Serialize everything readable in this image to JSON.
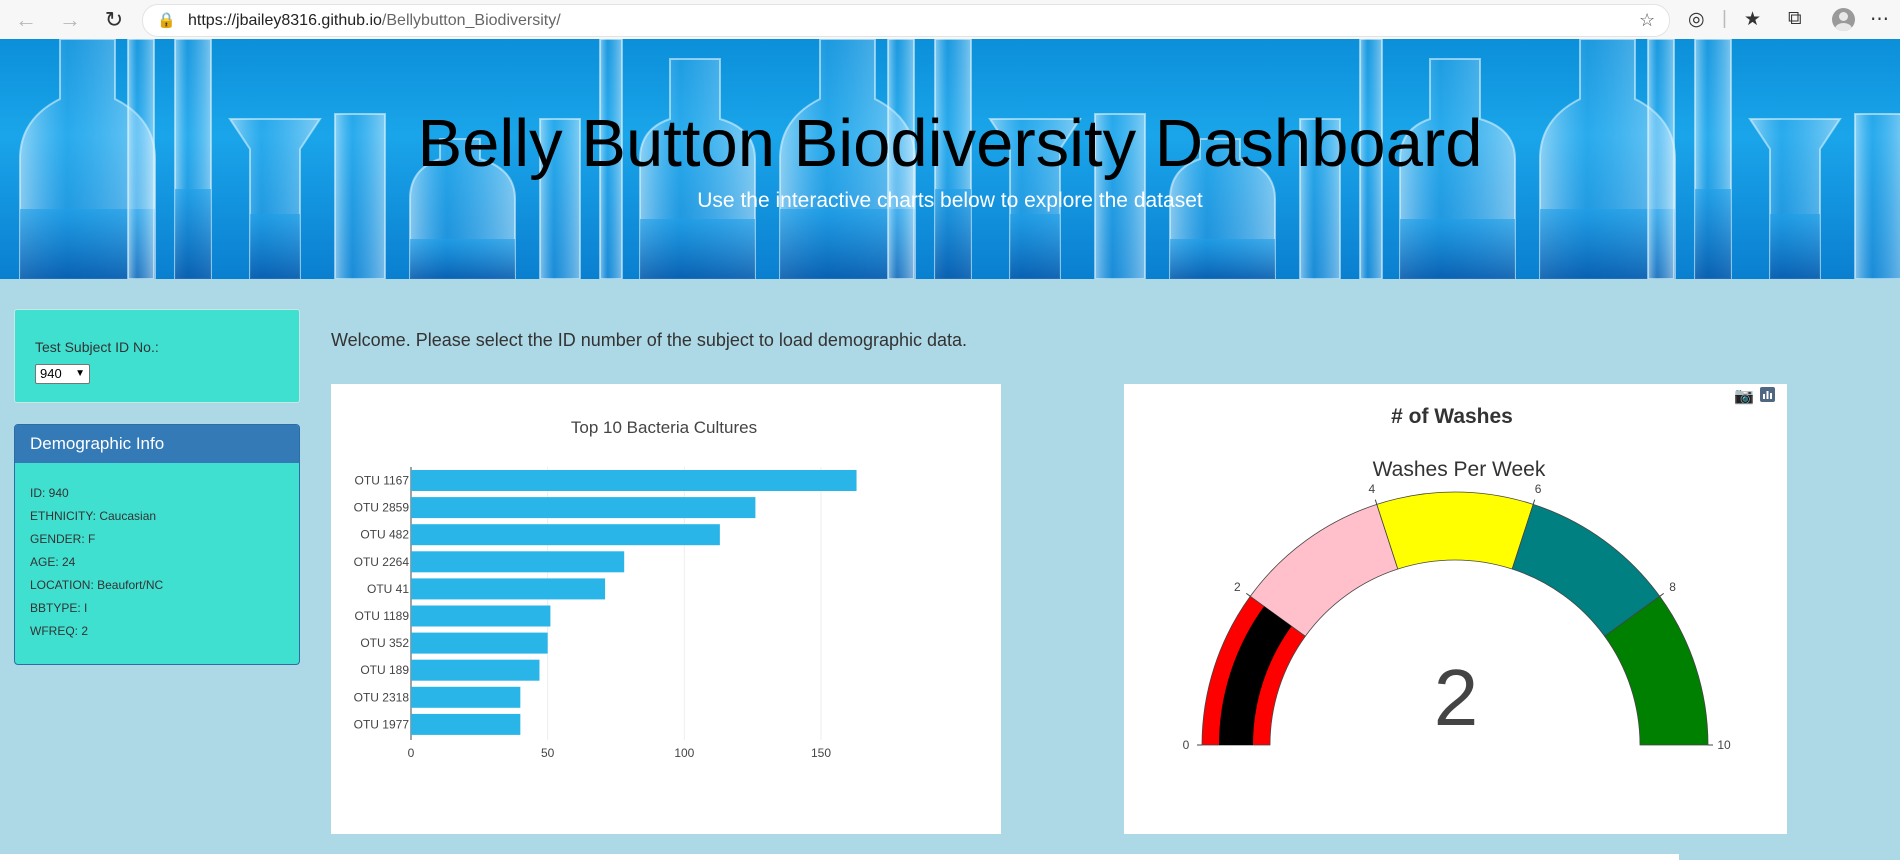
{
  "browser": {
    "url_host": "https://jbailey8316.github.io",
    "url_path": "/Bellybutton_Biodiversity/"
  },
  "hero": {
    "title": "Belly Button Biodiversity Dashboard",
    "subtitle": "Use the interactive charts below to explore the dataset"
  },
  "selector": {
    "label": "Test Subject ID No.:",
    "selected": "940"
  },
  "demographics": {
    "heading": "Demographic Info",
    "rows": [
      "ID: 940",
      "ETHNICITY: Caucasian",
      "GENDER: F",
      "AGE: 24",
      "LOCATION: Beaufort/NC",
      "BBTYPE: I",
      "WFREQ: 2"
    ]
  },
  "welcome": "Welcome. Please select the ID number of the subject to load demographic data.",
  "colors": {
    "page_bg": "#add8e6",
    "panel_bg": "#40e0d0",
    "header_blue": "#337ab7",
    "bar": "#29b5e8"
  },
  "chart_data": [
    {
      "type": "bar",
      "orientation": "horizontal",
      "title": "Top 10 Bacteria Cultures",
      "categories": [
        "OTU 1167",
        "OTU 2859",
        "OTU 482",
        "OTU 2264",
        "OTU 41",
        "OTU 1189",
        "OTU 352",
        "OTU 189",
        "OTU 2318",
        "OTU 1977"
      ],
      "values": [
        163,
        126,
        113,
        78,
        71,
        51,
        50,
        47,
        40,
        40
      ],
      "xticks": [
        0,
        50,
        100,
        150
      ],
      "xlim": [
        0,
        170
      ],
      "grid": true
    },
    {
      "type": "gauge",
      "title": "# of Washes",
      "subtitle": "Washes Per Week",
      "value": 2,
      "range": [
        0,
        10
      ],
      "ticks": [
        0,
        2,
        4,
        6,
        8,
        10
      ],
      "steps": [
        {
          "range": [
            0,
            2
          ],
          "color": "#ff0000"
        },
        {
          "range": [
            2,
            4
          ],
          "color": "#ffc0cb"
        },
        {
          "range": [
            4,
            6
          ],
          "color": "#ffff00"
        },
        {
          "range": [
            6,
            8
          ],
          "color": "#008080"
        },
        {
          "range": [
            8,
            10
          ],
          "color": "#008000"
        }
      ],
      "bar_color": "#000000"
    }
  ]
}
